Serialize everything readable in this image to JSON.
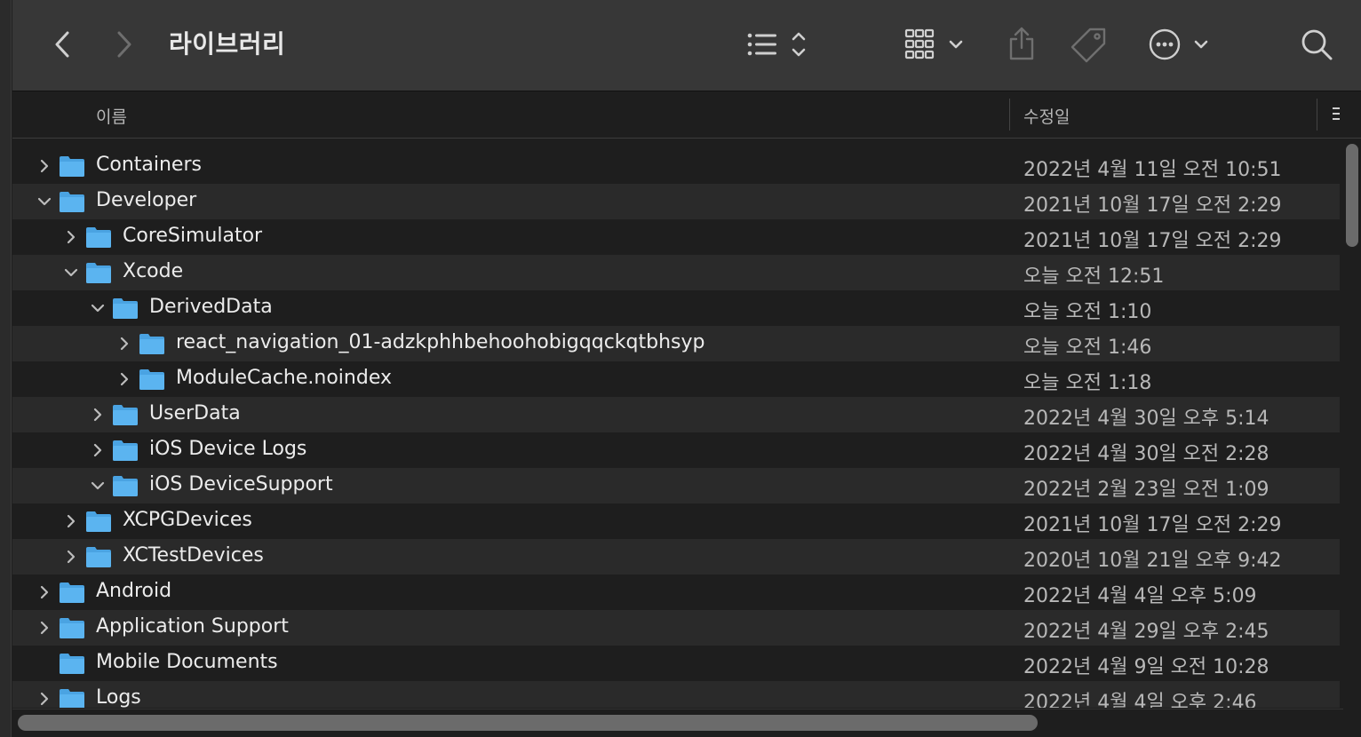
{
  "window": {
    "title": "라이브러리"
  },
  "toolbar": {
    "back_icon": "chevron-left-icon",
    "forward_icon": "chevron-right-icon",
    "view_icon": "list-view-icon",
    "group_icon": "grid-group-icon",
    "share_icon": "share-icon",
    "tag_icon": "tag-icon",
    "more_icon": "ellipsis-circle-icon",
    "search_icon": "search-icon"
  },
  "columns": {
    "name": "이름",
    "date": "수정일"
  },
  "rows": [
    {
      "name": "Containers",
      "date": "2022년 4월 11일 오전 10:51",
      "level": 0,
      "state": "collapsed"
    },
    {
      "name": "Developer",
      "date": "2021년 10월 17일 오전 2:29",
      "level": 0,
      "state": "expanded"
    },
    {
      "name": "CoreSimulator",
      "date": "2021년 10월 17일 오전 2:29",
      "level": 1,
      "state": "collapsed"
    },
    {
      "name": "Xcode",
      "date": "오늘 오전 12:51",
      "level": 1,
      "state": "expanded"
    },
    {
      "name": "DerivedData",
      "date": "오늘 오전 1:10",
      "level": 2,
      "state": "expanded"
    },
    {
      "name": "react_navigation_01-adzkphhbehoohobigqqckqtbhsyp",
      "date": "오늘 오전 1:46",
      "level": 3,
      "state": "collapsed"
    },
    {
      "name": "ModuleCache.noindex",
      "date": "오늘 오전 1:18",
      "level": 3,
      "state": "collapsed"
    },
    {
      "name": "UserData",
      "date": "2022년 4월 30일 오후 5:14",
      "level": 2,
      "state": "collapsed"
    },
    {
      "name": "iOS Device Logs",
      "date": "2022년 4월 30일 오전 2:28",
      "level": 2,
      "state": "collapsed"
    },
    {
      "name": "iOS DeviceSupport",
      "date": "2022년 2월 23일 오전 1:09",
      "level": 2,
      "state": "expanded"
    },
    {
      "name": "XCPGDevices",
      "date": "2021년 10월 17일 오전 2:29",
      "level": 1,
      "state": "collapsed"
    },
    {
      "name": "XCTestDevices",
      "date": "2020년 10월 21일 오후 9:42",
      "level": 1,
      "state": "collapsed"
    },
    {
      "name": "Android",
      "date": "2022년 4월 4일 오후 5:09",
      "level": 0,
      "state": "collapsed"
    },
    {
      "name": "Application Support",
      "date": "2022년 4월 29일 오후 2:45",
      "level": 0,
      "state": "collapsed"
    },
    {
      "name": "Mobile Documents",
      "date": "2022년 4월 9일 오전 10:28",
      "level": 0,
      "state": "none"
    },
    {
      "name": "Logs",
      "date": "2022년 4월 4일 오후 2:46",
      "level": 0,
      "state": "collapsed"
    }
  ],
  "colors": {
    "folder_blue": "#5bb4f0",
    "folder_tab": "#4aa3e2",
    "toolbar_bg": "#373737",
    "row_alt": "#2a2a2a"
  }
}
